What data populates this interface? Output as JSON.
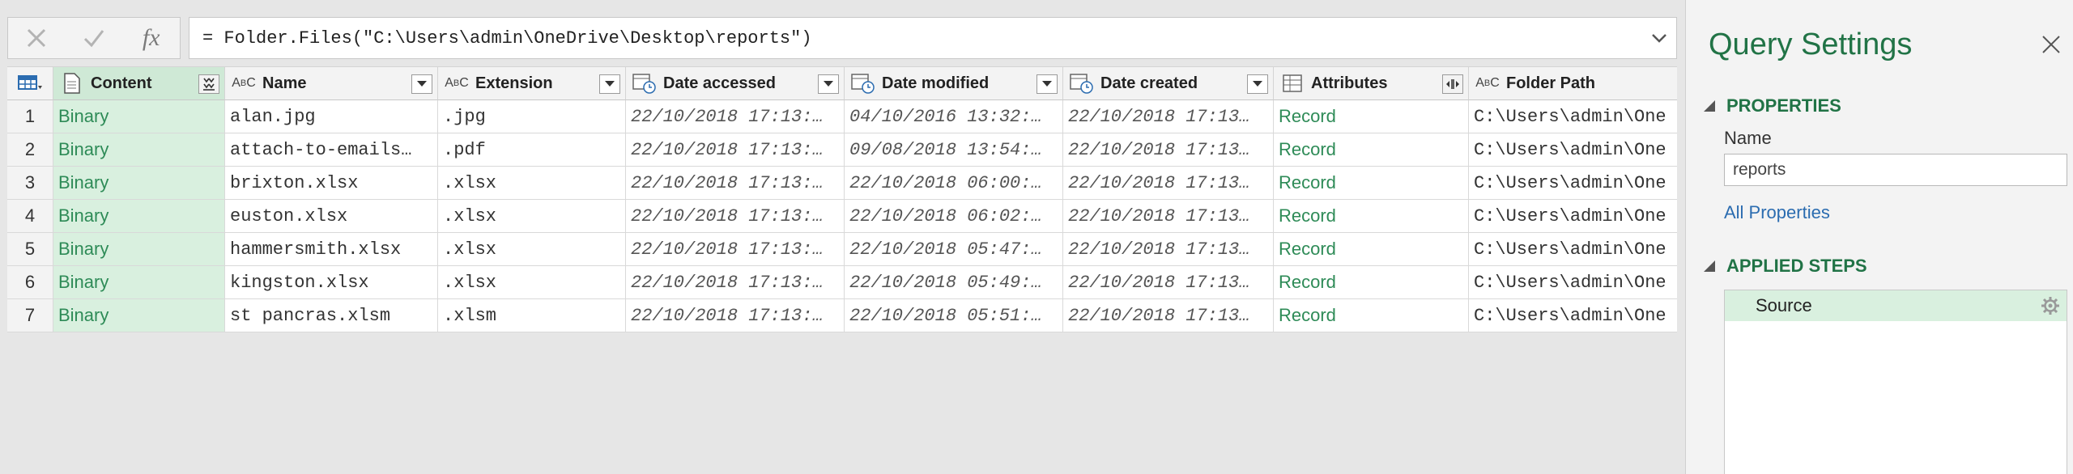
{
  "formula_bar": {
    "cancel_icon": "close-icon",
    "commit_icon": "check-icon",
    "fx_label": "fx",
    "formula": "= Folder.Files(\"C:\\Users\\admin\\OneDrive\\Desktop\\reports\")"
  },
  "grid": {
    "columns": [
      {
        "name": "Content",
        "type_icon": "binary-type-icon",
        "button": "expand-binary-icon"
      },
      {
        "name": "Name",
        "type_icon": "text-type-icon",
        "button": "filter-dropdown-icon"
      },
      {
        "name": "Extension",
        "type_icon": "text-type-icon",
        "button": "filter-dropdown-icon"
      },
      {
        "name": "Date accessed",
        "type_icon": "datetime-type-icon",
        "button": "filter-dropdown-icon"
      },
      {
        "name": "Date modified",
        "type_icon": "datetime-type-icon",
        "button": "filter-dropdown-icon"
      },
      {
        "name": "Date created",
        "type_icon": "datetime-type-icon",
        "button": "filter-dropdown-icon"
      },
      {
        "name": "Attributes",
        "type_icon": "record-type-icon",
        "button": "expand-record-icon"
      },
      {
        "name": "Folder Path",
        "type_icon": "text-type-icon",
        "button": ""
      }
    ],
    "rows": [
      {
        "n": "1",
        "content": "Binary",
        "name": "alan.jpg",
        "ext": ".jpg",
        "accessed": "22/10/2018 17:13:…",
        "modified": "04/10/2016 13:32:…",
        "created": "22/10/2018 17:13…",
        "attr": "Record",
        "path": "C:\\Users\\admin\\One"
      },
      {
        "n": "2",
        "content": "Binary",
        "name": "attach-to-emails…",
        "ext": ".pdf",
        "accessed": "22/10/2018 17:13:…",
        "modified": "09/08/2018 13:54:…",
        "created": "22/10/2018 17:13…",
        "attr": "Record",
        "path": "C:\\Users\\admin\\One"
      },
      {
        "n": "3",
        "content": "Binary",
        "name": "brixton.xlsx",
        "ext": ".xlsx",
        "accessed": "22/10/2018 17:13:…",
        "modified": "22/10/2018 06:00:…",
        "created": "22/10/2018 17:13…",
        "attr": "Record",
        "path": "C:\\Users\\admin\\One"
      },
      {
        "n": "4",
        "content": "Binary",
        "name": "euston.xlsx",
        "ext": ".xlsx",
        "accessed": "22/10/2018 17:13:…",
        "modified": "22/10/2018 06:02:…",
        "created": "22/10/2018 17:13…",
        "attr": "Record",
        "path": "C:\\Users\\admin\\One"
      },
      {
        "n": "5",
        "content": "Binary",
        "name": "hammersmith.xlsx",
        "ext": ".xlsx",
        "accessed": "22/10/2018 17:13:…",
        "modified": "22/10/2018 05:47:…",
        "created": "22/10/2018 17:13…",
        "attr": "Record",
        "path": "C:\\Users\\admin\\One"
      },
      {
        "n": "6",
        "content": "Binary",
        "name": "kingston.xlsx",
        "ext": ".xlsx",
        "accessed": "22/10/2018 17:13:…",
        "modified": "22/10/2018 05:49:…",
        "created": "22/10/2018 17:13…",
        "attr": "Record",
        "path": "C:\\Users\\admin\\One"
      },
      {
        "n": "7",
        "content": "Binary",
        "name": "st pancras.xlsm",
        "ext": ".xlsm",
        "accessed": "22/10/2018 17:13:…",
        "modified": "22/10/2018 05:51:…",
        "created": "22/10/2018 17:13…",
        "attr": "Record",
        "path": "C:\\Users\\admin\\One"
      }
    ]
  },
  "query_settings": {
    "title": "Query Settings",
    "properties_header": "PROPERTIES",
    "name_label": "Name",
    "name_value": "reports",
    "all_properties_link": "All Properties",
    "applied_steps_header": "APPLIED STEPS",
    "steps": [
      {
        "label": "Source"
      }
    ]
  },
  "colors": {
    "accent_green": "#217346",
    "binary_bg": "#d9f0df",
    "binary_text": "#2e8b57",
    "link_blue": "#2b6cb0"
  }
}
